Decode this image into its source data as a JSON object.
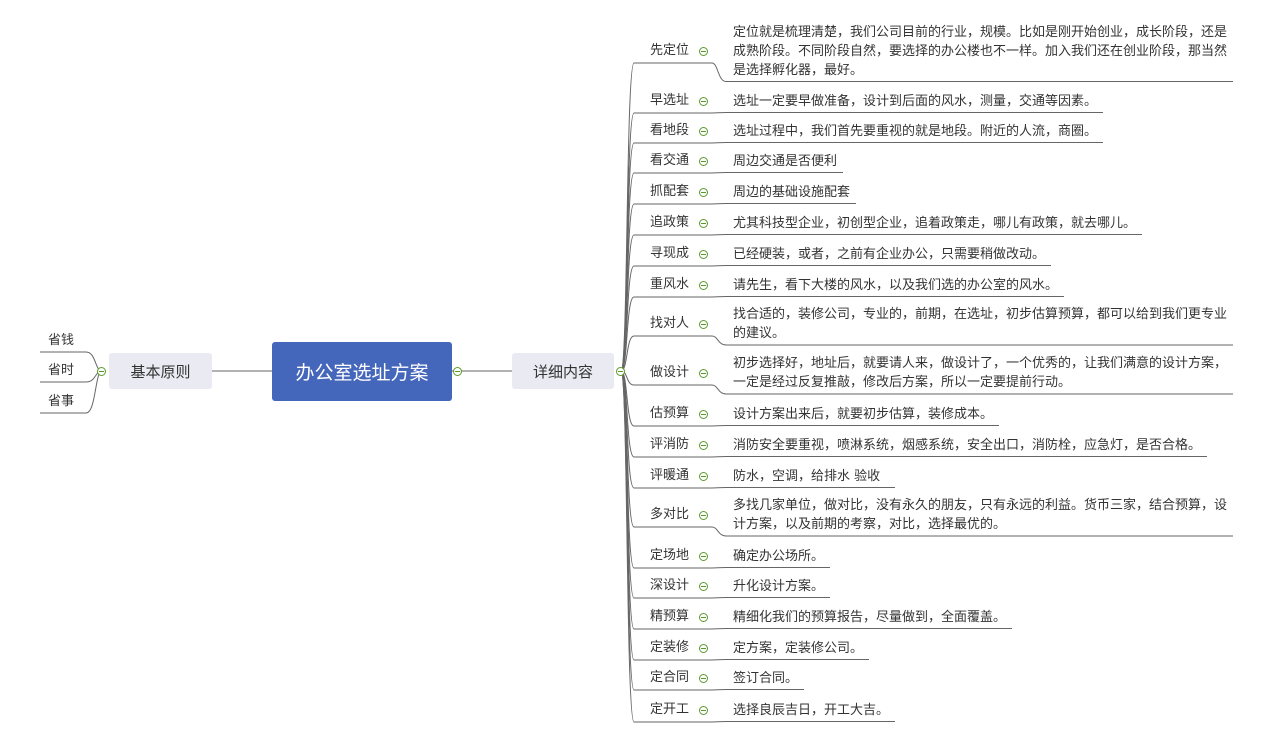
{
  "center": {
    "label": "办公室选址方案"
  },
  "left": {
    "label": "基本原则",
    "items": [
      "省钱",
      "省时",
      "省事"
    ]
  },
  "right": {
    "label": "详细内容",
    "items": [
      {
        "label": "先定位",
        "text": "定位就是梳理清楚，我们公司目前的行业，规模。比如是刚开始创业，成长阶段，还是成熟阶段。不同阶段自然，要选择的办公楼也不一样。加入我们还在创业阶段，那当然是选择孵化器，最好。"
      },
      {
        "label": "早选址",
        "text": "选址一定要早做准备，设计到后面的风水，测量，交通等因素。"
      },
      {
        "label": "看地段",
        "text": "选址过程中，我们首先要重视的就是地段。附近的人流，商圈。"
      },
      {
        "label": "看交通",
        "text": "周边交通是否便利"
      },
      {
        "label": "抓配套",
        "text": "周边的基础设施配套"
      },
      {
        "label": "追政策",
        "text": "尤其科技型企业，初创型企业，追着政策走，哪儿有政策，就去哪儿。"
      },
      {
        "label": "寻现成",
        "text": "已经硬装，或者，之前有企业办公，只需要稍做改动。"
      },
      {
        "label": "重风水",
        "text": "请先生，看下大楼的风水，以及我们选的办公室的风水。"
      },
      {
        "label": "找对人",
        "text": "找合适的，装修公司，专业的，前期，在选址，初步估算预算，都可以给到我们更专业的建议。"
      },
      {
        "label": "做设计",
        "text": "初步选择好，地址后，就要请人来，做设计了，一个优秀的，让我们满意的设计方案，一定是经过反复推敲，修改后方案，所以一定要提前行动。"
      },
      {
        "label": "估预算",
        "text": "设计方案出来后，就要初步估算，装修成本。"
      },
      {
        "label": "评消防",
        "text": "消防安全要重视，喷淋系统，烟感系统，安全出口，消防栓，应急灯，是否合格。"
      },
      {
        "label": "评暖通",
        "text": "防水，空调，给排水 验收"
      },
      {
        "label": "多对比",
        "text": "多找几家单位，做对比，没有永久的朋友，只有永远的利益。货币三家，结合预算，设计方案，以及前期的考察，对比，选择最优的。"
      },
      {
        "label": "定场地",
        "text": "确定办公场所。"
      },
      {
        "label": "深设计",
        "text": "升化设计方案。"
      },
      {
        "label": "精预算",
        "text": "精细化我们的预算报告，尽量做到，全面覆盖。"
      },
      {
        "label": "定装修",
        "text": "定方案，定装修公司。"
      },
      {
        "label": "定合同",
        "text": "签订合同。"
      },
      {
        "label": "定开工",
        "text": "选择良辰吉日，开工大吉。"
      }
    ]
  },
  "colors": {
    "center_bg": "#4466bb",
    "mid_bg": "#e9eaf2",
    "line": "#666666",
    "toggle": "#5a9a2a"
  }
}
